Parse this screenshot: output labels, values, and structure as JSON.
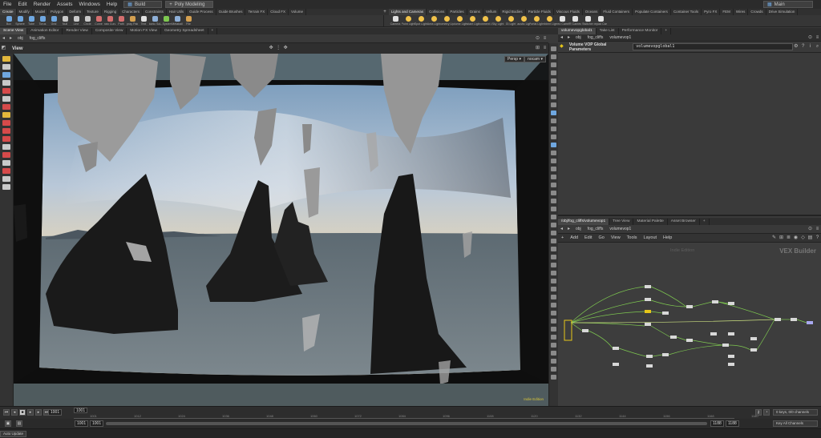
{
  "menubar": {
    "items": [
      "File",
      "Edit",
      "Render",
      "Assets",
      "Windows",
      "Help"
    ],
    "desktop": "Build",
    "shelf_set": "Poly Modeling",
    "right_desktop": "Main"
  },
  "shelf": {
    "left_tabs": [
      "Create",
      "Modify",
      "Model",
      "Polygon",
      "Deform",
      "Texture",
      "Rigging",
      "Characters",
      "Constraints",
      "Hair Utils",
      "Guide Process",
      "Guide Brushes",
      "Terrain FX",
      "Cloud FX",
      "Volume"
    ],
    "left_tools": [
      "Box",
      "Sphere",
      "Tube",
      "Torus",
      "Grid",
      "Null",
      "Line",
      "Circle",
      "Curve",
      "Draw Curve",
      "Path",
      "Spray Paint",
      "Text",
      "Platonic Solids",
      "L-System",
      "Metaball",
      "File"
    ],
    "right_tabs": [
      "Lights and Cameras",
      "Collisions",
      "Particles",
      "Grains",
      "Vellum",
      "Rigid Bodies",
      "Particle Fluids",
      "Viscous Fluids",
      "Oceans",
      "Fluid Containers",
      "Populate Containers",
      "Container Tools",
      "Pyro FX",
      "FEM",
      "Wires",
      "Crowds",
      "Drive Simulation"
    ],
    "right_tools": [
      "Camera",
      "Point Light",
      "Spot Light",
      "Area Light",
      "Geometry Light",
      "Volume Light",
      "Distant Light",
      "Environment Light",
      "Sky Light",
      "GI Light",
      "Caustic Light",
      "Portal Light",
      "Ambient Light",
      "Stereo Camera",
      "VR Camera",
      "Switcher",
      "Gamepad Camera"
    ]
  },
  "left_panes": {
    "tabs": [
      "Scene View",
      "Animation Editor",
      "Render View",
      "Composite View",
      "Motion FX View",
      "Geometry Spreadsheet"
    ],
    "path": [
      "obj",
      "fog_cliffs"
    ],
    "view_title": "View",
    "persp": "Persp ▾",
    "camera": "nocam ▾",
    "edition": "Indie Edition"
  },
  "right_top": {
    "tabs": [
      "volumevopglobal1",
      "Take List",
      "Performance Monitor"
    ],
    "path": [
      "obj",
      "fog_cliffs",
      "volumevop1"
    ],
    "param_title": "Volume VOP Global Parameters",
    "param_name": "volumevopglobal1"
  },
  "network": {
    "tabs": [
      "/obj/fog_cliffs/volumevop1",
      "Tree View",
      "Material Palette",
      "Asset Browser"
    ],
    "path": [
      "obj",
      "fog_cliffs",
      "volumevop1"
    ],
    "menu": [
      "Add",
      "Edit",
      "Go",
      "View",
      "Tools",
      "Layout",
      "Help"
    ],
    "watermark": "Indie Edition",
    "context": "VEX Builder"
  },
  "timeline": {
    "current_frame": "1001",
    "frame_marker": "1001",
    "ticks": [
      "1001",
      "1012",
      "1024",
      "1036",
      "1048",
      "1060",
      "1072",
      "1084",
      "1096",
      "1108",
      "1120",
      "1132",
      "1144",
      "1156",
      "1168",
      "1180"
    ],
    "start": "1001",
    "start2": "1001",
    "end": "1188",
    "end2": "1188",
    "keys_label": "0 keys, 0/0 channels",
    "key_all": "Key All Channels",
    "auto_update": "Auto Update"
  },
  "colors": {
    "accent_yellow": "#d9c73a",
    "wire_green": "#7ec850",
    "node_selected": "#e6c619"
  }
}
